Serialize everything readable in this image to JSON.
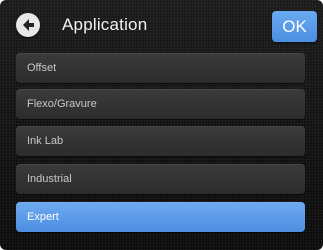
{
  "header": {
    "back_icon": "back-arrow-icon",
    "title": "Application",
    "ok_label": "OK"
  },
  "menu": {
    "items": [
      {
        "label": "Offset",
        "selected": false
      },
      {
        "label": "Flexo/Gravure",
        "selected": false
      },
      {
        "label": "Ink Lab",
        "selected": false
      },
      {
        "label": "Industrial",
        "selected": false
      },
      {
        "label": "Expert",
        "selected": true
      }
    ]
  },
  "colors": {
    "accent": "#5a9be8",
    "item_background": "#333333",
    "screen_background": "#111111"
  }
}
